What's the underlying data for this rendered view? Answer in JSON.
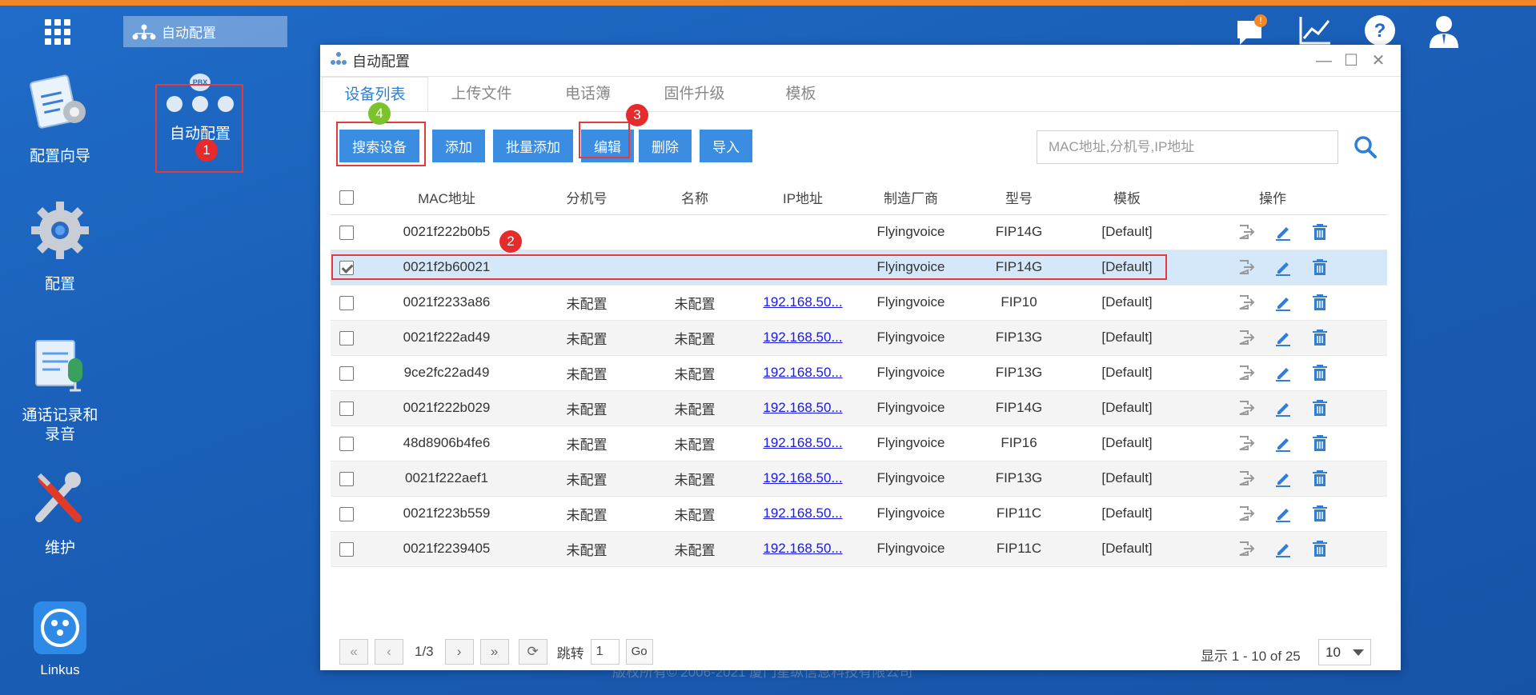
{
  "desktop": {
    "task_tab": "自动配置",
    "icons": [
      {
        "label": "配置向导"
      },
      {
        "label": "配置"
      },
      {
        "label_line1": "通话记录和",
        "label_line2": "录音"
      },
      {
        "label": "维护"
      },
      {
        "label": "Linkus"
      }
    ],
    "app_label": "自动配置",
    "pbx_badge": "PBX",
    "copyright": "版权所有© 2006-2021 厦门星纵信息科技有限公司",
    "notification_badge": "!"
  },
  "annotations": {
    "step1": "1",
    "step2": "2",
    "step3": "3",
    "step4": "4"
  },
  "window": {
    "title": "自动配置",
    "tabs": [
      "设备列表",
      "上传文件",
      "电话簿",
      "固件升级",
      "模板"
    ],
    "toolbar": {
      "search_devices": "搜索设备",
      "add": "添加",
      "bulk_add": "批量添加",
      "edit": "编辑",
      "delete": "删除",
      "import": "导入"
    },
    "search_placeholder": "MAC地址,分机号,IP地址",
    "columns": [
      "MAC地址",
      "分机号",
      "名称",
      "IP地址",
      "制造厂商",
      "型号",
      "模板",
      "操作"
    ],
    "rows": [
      {
        "mac": "0021f222b0b5",
        "ext": "",
        "name": "",
        "ip": "",
        "vendor": "Flyingvoice",
        "model": "FIP14G",
        "template": "[Default]"
      },
      {
        "mac": "0021f2b60021",
        "ext": "",
        "name": "",
        "ip": "",
        "vendor": "Flyingvoice",
        "model": "FIP14G",
        "template": "[Default]"
      },
      {
        "mac": "0021f2233a86",
        "ext": "未配置",
        "name": "未配置",
        "ip": "192.168.50...",
        "vendor": "Flyingvoice",
        "model": "FIP10",
        "template": "[Default]"
      },
      {
        "mac": "0021f222ad49",
        "ext": "未配置",
        "name": "未配置",
        "ip": "192.168.50...",
        "vendor": "Flyingvoice",
        "model": "FIP13G",
        "template": "[Default]"
      },
      {
        "mac": "9ce2fc22ad49",
        "ext": "未配置",
        "name": "未配置",
        "ip": "192.168.50...",
        "vendor": "Flyingvoice",
        "model": "FIP13G",
        "template": "[Default]"
      },
      {
        "mac": "0021f222b029",
        "ext": "未配置",
        "name": "未配置",
        "ip": "192.168.50...",
        "vendor": "Flyingvoice",
        "model": "FIP14G",
        "template": "[Default]"
      },
      {
        "mac": "48d8906b4fe6",
        "ext": "未配置",
        "name": "未配置",
        "ip": "192.168.50...",
        "vendor": "Flyingvoice",
        "model": "FIP16",
        "template": "[Default]"
      },
      {
        "mac": "0021f222aef1",
        "ext": "未配置",
        "name": "未配置",
        "ip": "192.168.50...",
        "vendor": "Flyingvoice",
        "model": "FIP13G",
        "template": "[Default]"
      },
      {
        "mac": "0021f223b559",
        "ext": "未配置",
        "name": "未配置",
        "ip": "192.168.50...",
        "vendor": "Flyingvoice",
        "model": "FIP11C",
        "template": "[Default]"
      },
      {
        "mac": "0021f2239405",
        "ext": "未配置",
        "name": "未配置",
        "ip": "192.168.50...",
        "vendor": "Flyingvoice",
        "model": "FIP11C",
        "template": "[Default]"
      }
    ],
    "pager": {
      "page": "1/3",
      "jump_label": "跳转",
      "jump_value": "1",
      "go": "Go",
      "info": "显示 1 - 10 of 25",
      "page_size": "10"
    }
  }
}
